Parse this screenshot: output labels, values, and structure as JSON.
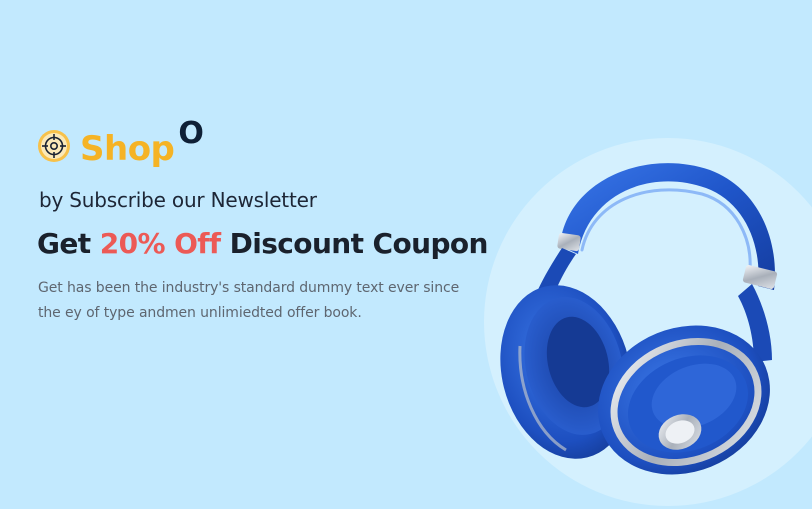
{
  "brand": {
    "name": "Shop",
    "suffix": "O",
    "primary_color": "#f5b325",
    "dark_color": "#0f2036"
  },
  "banner": {
    "subtitle": "by Subscribe our Newsletter",
    "headline_prefix": "Get ",
    "headline_highlight": "20% Off",
    "headline_suffix": " Discount Coupon",
    "description": "Get has been the industry's standard dummy text ever since the ey of type andmen unlimiedted offer book.",
    "accent_color": "#ec5a56",
    "background_color": "#c2e9fe"
  },
  "product": {
    "icon": "headphones-image",
    "color": "#1f55c9"
  }
}
